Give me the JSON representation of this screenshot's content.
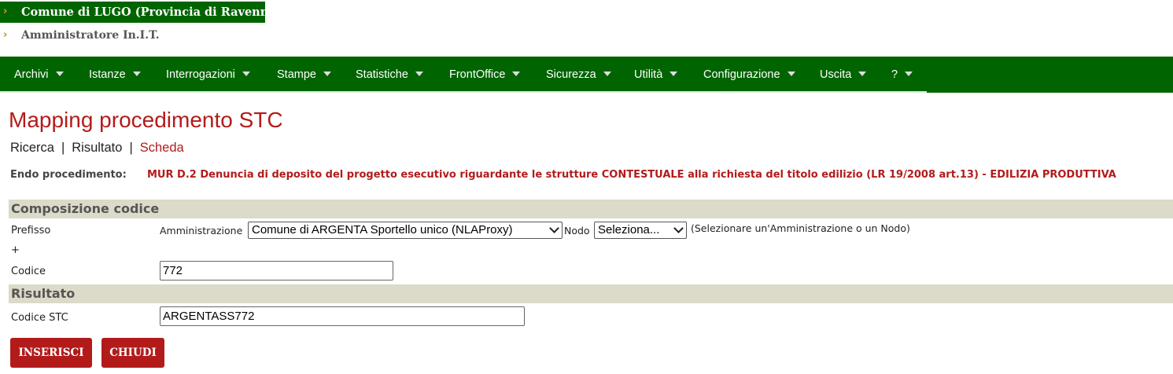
{
  "header": {
    "organization": "Comune di LUGO (Provincia di Ravenna)",
    "user": "Amministratore In.I.T.",
    "arrow_icon": "chevron-right-icon"
  },
  "menu": {
    "items": [
      "Archivi",
      "Istanze",
      "Interrogazioni",
      "Stampe",
      "Statistiche",
      "FrontOffice",
      "Sicurezza",
      "Utilità",
      "Configurazione",
      "Uscita",
      "?"
    ]
  },
  "page": {
    "title": "Mapping procedimento STC",
    "breadcrumb": [
      "Ricerca",
      "Risultato",
      "Scheda"
    ],
    "breadcrumb_separator": "|",
    "endo_label": "Endo procedimento:",
    "endo_value": "MUR D.2 Denuncia di deposito del progetto esecutivo riguardante le strutture CONTESTUALE alla richiesta del titolo edilizio (LR 19/2008 art.13) - EDILIZIA PRODUTTIVA"
  },
  "composizione": {
    "heading": "Composizione codice",
    "prefisso_label": "Prefisso",
    "amministrazione_label": "Amministrazione",
    "amministrazione_value": "Comune di ARGENTA Sportello unico (NLAProxy)",
    "nodo_label": "Nodo",
    "nodo_value": "Seleziona...",
    "hint": "(Selezionare un'Amministrazione o un Nodo)",
    "plus": "+",
    "codice_label": "Codice",
    "codice_value": "772"
  },
  "risultato": {
    "heading": "Risultato",
    "codice_stc_label": "Codice STC",
    "codice_stc_value": "ARGENTASS772"
  },
  "buttons": {
    "insert": "INSERISCI",
    "close": "CHIUDI"
  },
  "colors": {
    "green": "#006400",
    "red": "#b31b1b",
    "section_bg": "#dcdac8"
  }
}
